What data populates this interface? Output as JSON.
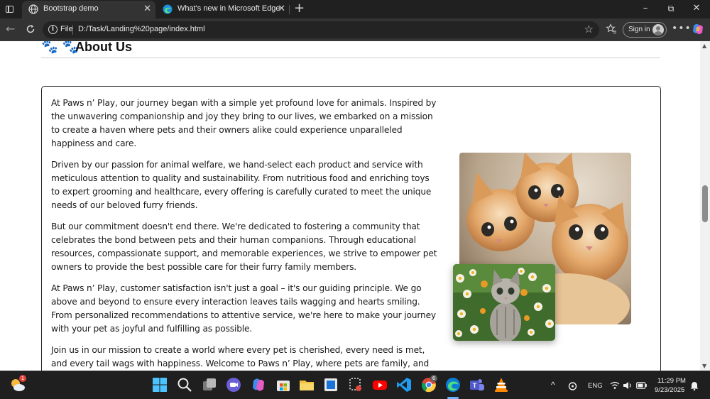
{
  "browser": {
    "tabs": [
      {
        "label": "Bootstrap demo",
        "active": true,
        "icon": "globe-icon"
      },
      {
        "label": "What's new in Microsoft Edge",
        "active": false,
        "icon": "edge-icon"
      }
    ],
    "address": {
      "scheme": "File",
      "url": "D:/Task/Landing%20page/index.html"
    },
    "signin_label": "Sign in",
    "window_controls": {
      "minimize": "–",
      "restore": "⧉",
      "close": "✕"
    }
  },
  "page": {
    "heading_icons": "🐾 🐾",
    "heading": "About Us",
    "paragraphs": [
      "At Paws n’ Play, our journey began with a simple yet profound love for animals. Inspired by the unwavering companionship and joy they bring to our lives, we embarked on a mission to create a haven where pets and their owners alike could experience unparalleled happiness and care.",
      "Driven by our passion for animal welfare, we hand-select each product and service with meticulous attention to quality and sustainability. From nutritious food and enriching toys to expert grooming and healthcare, every offering is carefully curated to meet the unique needs of our beloved furry friends.",
      "But our commitment doesn't end there. We're dedicated to fostering a community that celebrates the bond between pets and their human companions. Through educational resources, compassionate support, and memorable experiences, we strive to empower pet owners to provide the best possible care for their furry family members.",
      "At Paws n’ Play, customer satisfaction isn't just a goal – it's our guiding principle. We go above and beyond to ensure every interaction leaves tails wagging and hearts smiling. From personalized recommendations to attentive service, we're here to make your journey with your pet as joyful and fulfilling as possible.",
      "Join us in our mission to create a world where every pet is cherished, every need is met, and every tail wags with happiness. Welcome to Paws n’ Play, where pets are family, and love knows no bounds."
    ],
    "images": {
      "main": "three-kittens-photo",
      "small": "kitten-in-flowers-photo"
    }
  },
  "taskbar": {
    "weather_badge": "1",
    "chrome_badge": "6",
    "language": "ENG",
    "time": "11:29 PM",
    "date": "9/23/2025"
  },
  "colors": {
    "edge_blue": "#0c7bd6",
    "page_bg": "#ffffff",
    "chrome_dark": "#202020"
  }
}
